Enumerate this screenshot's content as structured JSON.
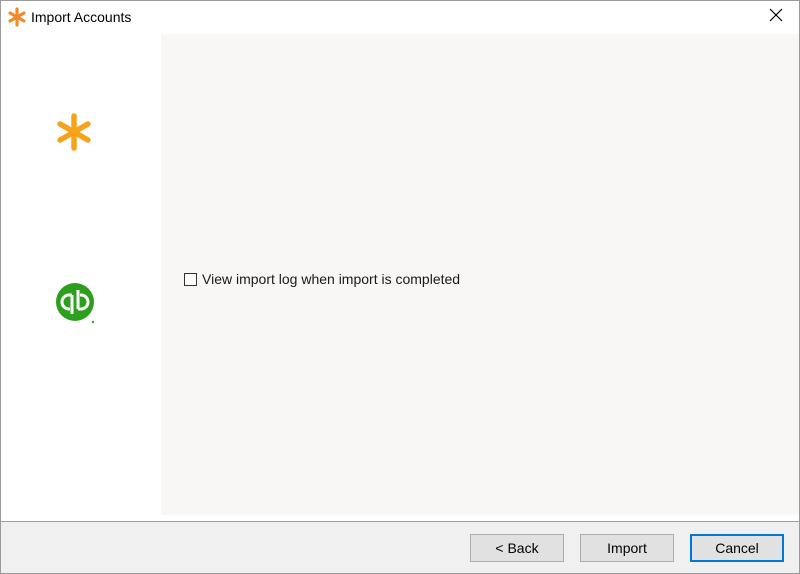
{
  "window": {
    "title": "Import Accounts",
    "title_icon": "asterisk-icon",
    "close_icon": "close-icon"
  },
  "sidebar": {
    "logos": [
      {
        "name": "brand-asterisk-logo",
        "color": "#f7a21b"
      },
      {
        "name": "quickbooks-logo",
        "color": "#2ca01c"
      }
    ]
  },
  "main": {
    "log_checkbox": {
      "label": "View import log when import is completed",
      "checked": false
    }
  },
  "footer": {
    "back_label": "< Back",
    "import_label": "Import",
    "cancel_label": "Cancel"
  },
  "colors": {
    "accent": "#0078d7",
    "brand_orange": "#f7a21b",
    "title_icon_orange": "#f08a2b",
    "quickbooks_green": "#2ca01c",
    "panel_bg": "#f8f7f5",
    "button_bg": "#e1e1e1"
  }
}
